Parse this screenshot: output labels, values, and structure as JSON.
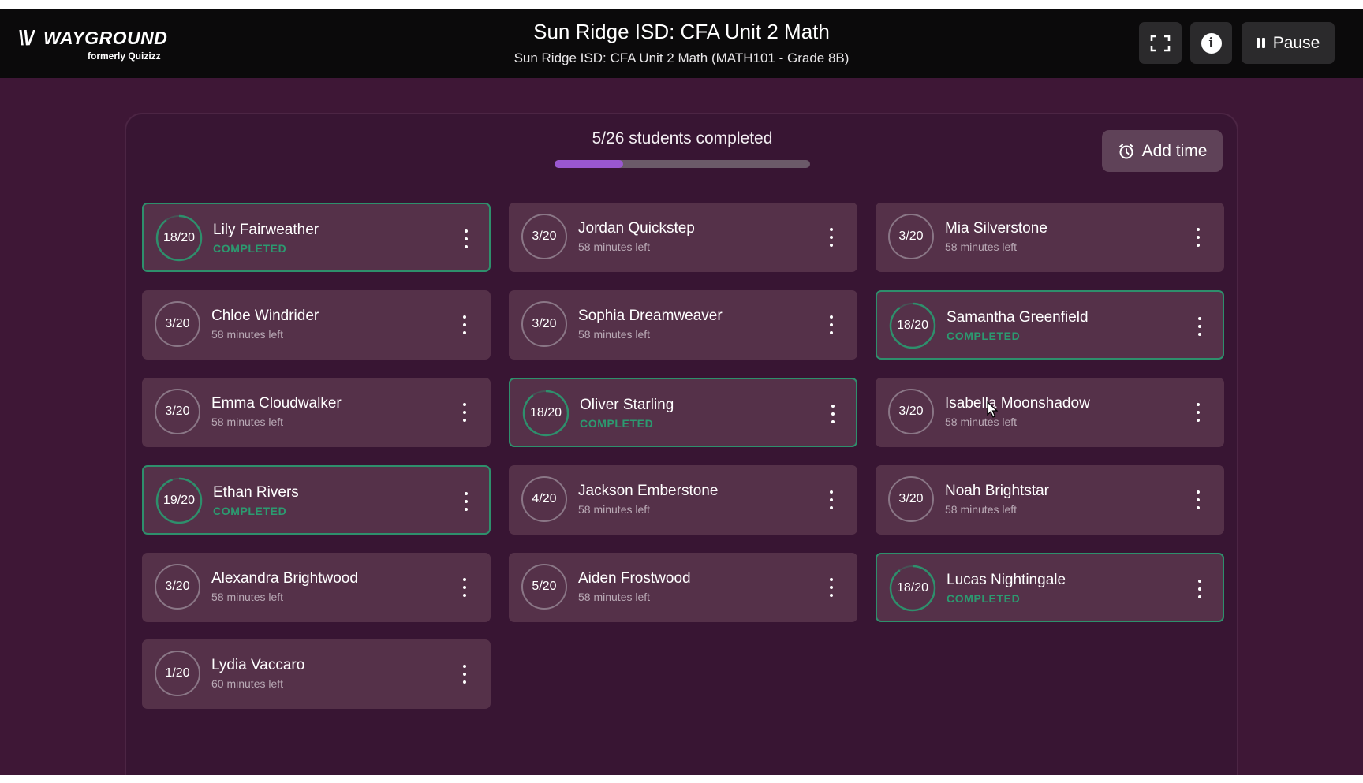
{
  "header": {
    "logo_text": "WAYGROUND",
    "logo_subtext": "formerly Quizizz",
    "title": "Sun Ridge ISD: CFA Unit 2 Math",
    "subtitle": "Sun Ridge ISD: CFA Unit 2 Math (MATH101 - Grade 8B)",
    "fullscreen_icon": "fullscreen-icon",
    "info_icon": "info-icon",
    "pause_label": "Pause"
  },
  "progress": {
    "label": "5/26 students completed",
    "completed": 5,
    "total": 26,
    "fill_fraction": 0.27
  },
  "add_time_label": "Add time",
  "colors": {
    "completed_accent": "#2e8f6c",
    "progress_fill": "#9a57d0",
    "background": "#3e1736"
  },
  "students": [
    {
      "score": "18/20",
      "progress": 0.9,
      "name": "Lily Fairweather",
      "status": "COMPLETED",
      "completed": true
    },
    {
      "score": "3/20",
      "progress": 0.15,
      "name": "Jordan Quickstep",
      "status": "58 minutes left",
      "completed": false
    },
    {
      "score": "3/20",
      "progress": 0.15,
      "name": "Mia Silverstone",
      "status": "58 minutes left",
      "completed": false
    },
    {
      "score": "3/20",
      "progress": 0.15,
      "name": "Chloe Windrider",
      "status": "58 minutes left",
      "completed": false
    },
    {
      "score": "3/20",
      "progress": 0.15,
      "name": "Sophia Dreamweaver",
      "status": "58 minutes left",
      "completed": false
    },
    {
      "score": "18/20",
      "progress": 0.9,
      "name": "Samantha Greenfield",
      "status": "COMPLETED",
      "completed": true
    },
    {
      "score": "3/20",
      "progress": 0.15,
      "name": "Emma Cloudwalker",
      "status": "58 minutes left",
      "completed": false
    },
    {
      "score": "18/20",
      "progress": 0.9,
      "name": "Oliver Starling",
      "status": "COMPLETED",
      "completed": true
    },
    {
      "score": "3/20",
      "progress": 0.15,
      "name": "Isabella Moonshadow",
      "status": "58 minutes left",
      "completed": false
    },
    {
      "score": "19/20",
      "progress": 0.95,
      "name": "Ethan Rivers",
      "status": "COMPLETED",
      "completed": true
    },
    {
      "score": "4/20",
      "progress": 0.2,
      "name": "Jackson Emberstone",
      "status": "58 minutes left",
      "completed": false
    },
    {
      "score": "3/20",
      "progress": 0.15,
      "name": "Noah Brightstar",
      "status": "58 minutes left",
      "completed": false
    },
    {
      "score": "3/20",
      "progress": 0.15,
      "name": "Alexandra Brightwood",
      "status": "58 minutes left",
      "completed": false
    },
    {
      "score": "5/20",
      "progress": 0.25,
      "name": "Aiden Frostwood",
      "status": "58 minutes left",
      "completed": false
    },
    {
      "score": "18/20",
      "progress": 0.9,
      "name": "Lucas Nightingale",
      "status": "COMPLETED",
      "completed": true
    },
    {
      "score": "1/20",
      "progress": 0.05,
      "name": "Lydia Vaccaro",
      "status": "60 minutes left",
      "completed": false
    }
  ]
}
